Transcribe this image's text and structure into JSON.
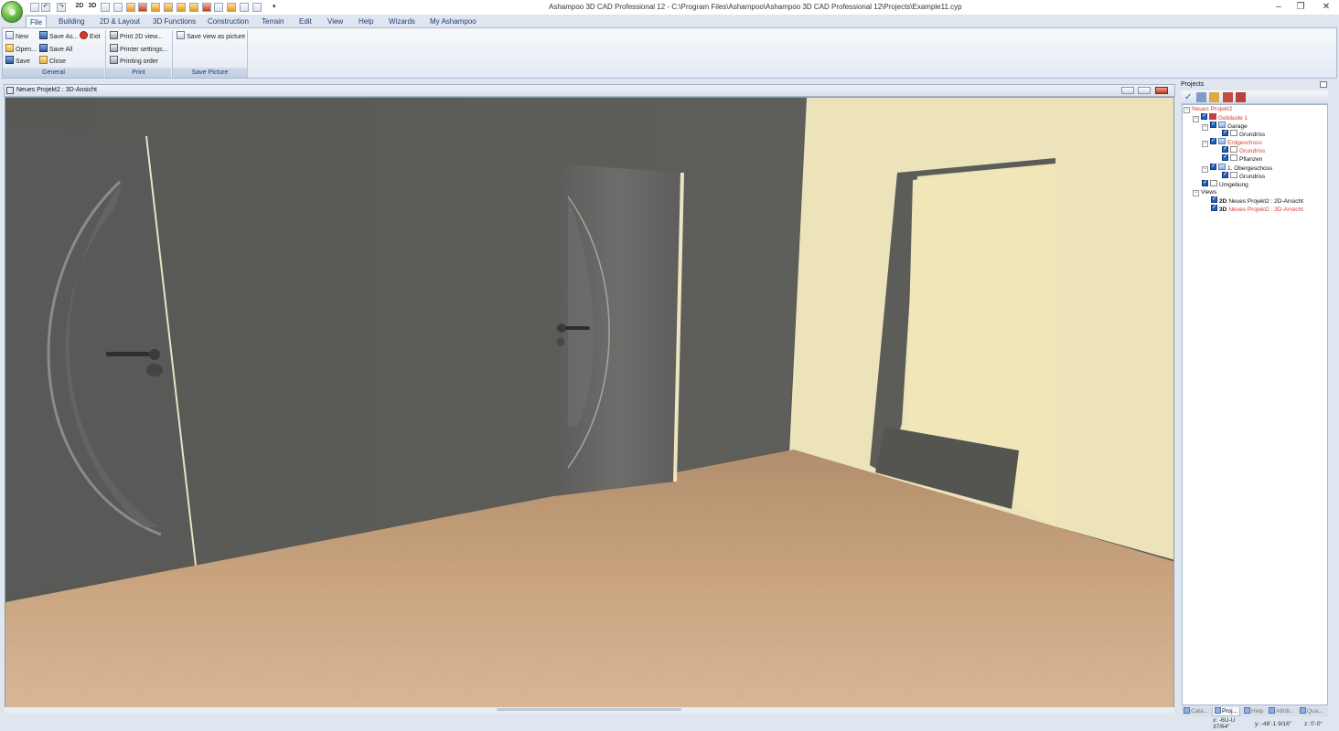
{
  "window": {
    "title": "Ashampoo 3D CAD Professional 12 - C:\\Program Files\\Ashampoo\\Ashampoo 3D CAD Professional 12\\Projects\\Example11.cyp",
    "controls": [
      "–",
      "❐",
      "✕"
    ]
  },
  "quick_access": [
    "2D",
    "3D"
  ],
  "menu": {
    "tabs": [
      "File",
      "Building",
      "2D & Layout",
      "3D Functions",
      "Construction",
      "Terrain",
      "Edit",
      "View",
      "Help",
      "Wizards",
      "My Ashampoo"
    ],
    "active": "File"
  },
  "ribbon": {
    "general": {
      "label": "General",
      "items": {
        "new": "New",
        "open": "Open...",
        "save": "Save",
        "save_as": "Save As...",
        "save_all": "Save All",
        "close": "Close",
        "exit": "Exit"
      }
    },
    "print": {
      "label": "Print",
      "items": {
        "print_2d": "Print 2D view...",
        "printer_settings": "Printer settings...",
        "printing_order": "Printing order"
      }
    },
    "save_picture": {
      "label": "Save Picture",
      "items": {
        "save_view": "Save view as picture"
      }
    }
  },
  "document": {
    "title": "Neues Projekt2 : 3D-Ansicht"
  },
  "panel": {
    "title": "Projects",
    "tree": {
      "project": "Neues Projekt2",
      "building": "Gebäude 1",
      "garage": "Garage",
      "garage_plan": "Grundriss",
      "ground_floor": "Erdgeschoss",
      "ground_plan": "Grundriss",
      "plants": "Pflanzen",
      "upper_floor": "1. Obergeschoss",
      "upper_plan": "Grundriss",
      "surroundings": "Umgebung",
      "views": "Views",
      "view_2d_tag": "2D",
      "view_2d": "Neues Projekt2 : 2D-Ansicht",
      "view_3d_tag": "3D",
      "view_3d": "Neues Projekt2 : 3D-Ansicht"
    },
    "bottom_tabs": [
      "Cata...",
      "Proj...",
      "Help",
      "Attrib...",
      "Qua..."
    ],
    "active_tab": "Proj..."
  },
  "status": {
    "x": "x: -6U-U 37/64\"",
    "y": "y: -48'-1 9/16\"",
    "z": "z: 0'-0\""
  },
  "colors": {
    "accent": "#1e3d74",
    "selected_red": "#d3403a",
    "checkbox_blue": "#1f5fbf",
    "wall_dark": "#5a5a56",
    "wall_light": "#efe8c3",
    "floor_wood": "#c9a27c"
  }
}
